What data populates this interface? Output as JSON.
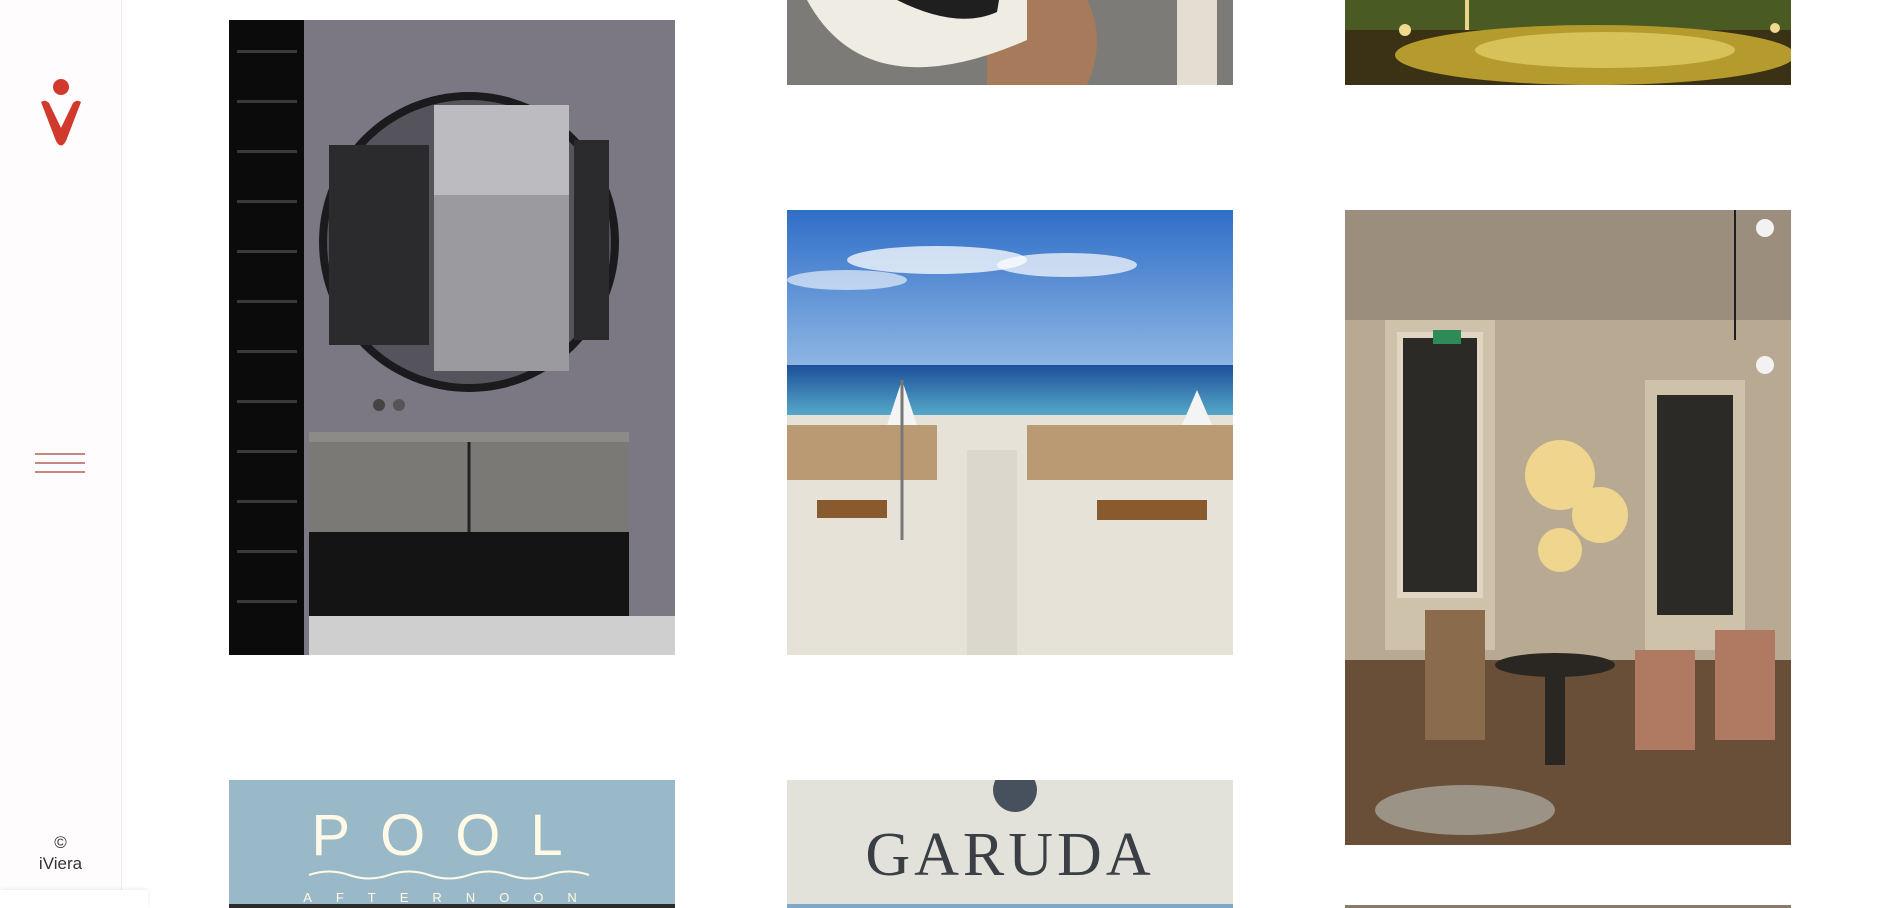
{
  "brand": {
    "logo_icon": "iviera-logo-icon",
    "logo_color": "#d0392b",
    "accent_color": "#c7877f"
  },
  "sidebar": {
    "menu_icon": "hamburger-menu-icon",
    "copyright_symbol": "©",
    "copyright_name": "iViera"
  },
  "gallery": {
    "tiles": [
      {
        "name": "hat-photo"
      },
      {
        "name": "pool-night-photo"
      },
      {
        "name": "bathroom-mirror-photo"
      },
      {
        "name": "beach-photo"
      },
      {
        "name": "restaurant-interior-photo"
      },
      {
        "name": "pool-afternoon-poster",
        "title": "POOL",
        "subtitle": "AFTERNOON"
      },
      {
        "name": "garuda-photo",
        "title": "GARUDA"
      }
    ]
  }
}
